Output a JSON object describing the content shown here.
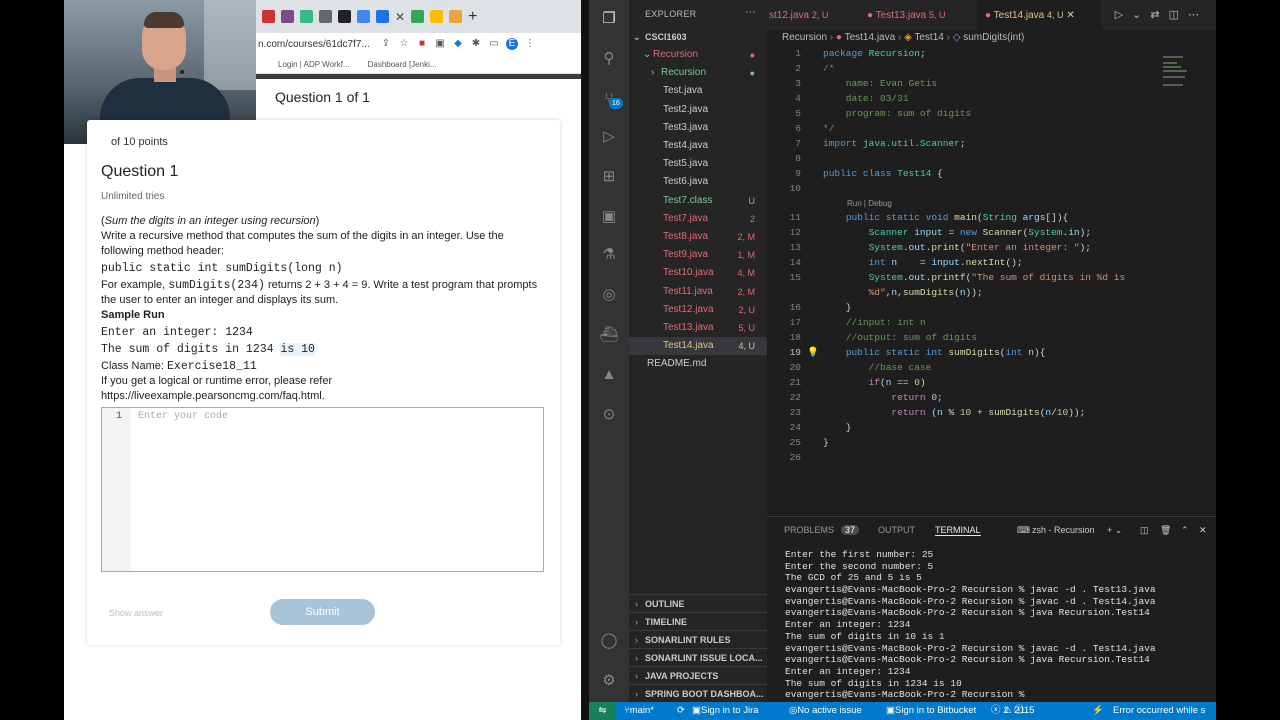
{
  "browser": {
    "url": "n.com/courses/61dc7f7...",
    "bookmarks": [
      "Login | ADP Workf...",
      "Dashboard [Jenki..."
    ],
    "question_header": "Question 1 of 1",
    "points_cut": "of 10 points",
    "question_title": "Question 1",
    "tries": "Unlimited tries",
    "prompt_italic": "Sum the digits in an integer using recursion",
    "prompt_line1": "Write a recursive method that computes the sum of the digits in an integer. Use the following method header:",
    "method_header": "public static int sumDigits(long n)",
    "example_prefix": "For example,",
    "example_code": "sumDigits(234)",
    "example_suffix": "returns 2 + 3 + 4 = 9. Write a test program that prompts the user to enter an integer and displays its sum.",
    "sample_run_label": "Sample Run",
    "sample_line1": "Enter an integer: 1234",
    "sample_line2a": "The sum of digits in 1234",
    "sample_line2b": "is 10",
    "class_name_label": "Class Name:",
    "class_name": "Exercise18_11",
    "error_note": "If you get a logical or runtime error, please refer https://liveexample.pearsoncmg.com/faq.html.",
    "editor_line": "1",
    "editor_placeholder": "Enter your code",
    "show_answer": "Show answer",
    "submit": "Submit"
  },
  "vscode": {
    "explorer_title": "EXPLORER",
    "project": "CSCI1603",
    "files": [
      {
        "name": "Recursion",
        "status": "",
        "color": "#e06c75",
        "indent": 2,
        "folder": "open"
      },
      {
        "name": "Recursion",
        "status": "",
        "color": "#73c991",
        "indent": 3,
        "folder": "closed"
      },
      {
        "name": "Test.java",
        "status": "",
        "color": "#cccccc",
        "indent": 3
      },
      {
        "name": "Test2.java",
        "status": "",
        "color": "#cccccc",
        "indent": 3
      },
      {
        "name": "Test3.java",
        "status": "",
        "color": "#cccccc",
        "indent": 3
      },
      {
        "name": "Test4.java",
        "status": "",
        "color": "#cccccc",
        "indent": 3
      },
      {
        "name": "Test5.java",
        "status": "",
        "color": "#cccccc",
        "indent": 3
      },
      {
        "name": "Test6.java",
        "status": "",
        "color": "#cccccc",
        "indent": 3
      },
      {
        "name": "Test7.class",
        "status": "U",
        "color": "#73c991",
        "indent": 3
      },
      {
        "name": "Test7.java",
        "status": "2",
        "color": "#e06c75",
        "indent": 3
      },
      {
        "name": "Test8.java",
        "status": "2, M",
        "color": "#e06c75",
        "indent": 3
      },
      {
        "name": "Test9.java",
        "status": "1, M",
        "color": "#e06c75",
        "indent": 3
      },
      {
        "name": "Test10.java",
        "status": "4, M",
        "color": "#e06c75",
        "indent": 3
      },
      {
        "name": "Test11.java",
        "status": "2, M",
        "color": "#e06c75",
        "indent": 3
      },
      {
        "name": "Test12.java",
        "status": "2, U",
        "color": "#e06c75",
        "indent": 3
      },
      {
        "name": "Test13.java",
        "status": "5, U",
        "color": "#e06c75",
        "indent": 3
      },
      {
        "name": "Test14.java",
        "status": "4, U",
        "color": "#e2c08d",
        "indent": 3,
        "selected": true
      },
      {
        "name": "README.md",
        "status": "",
        "color": "#cccccc",
        "indent": 2
      }
    ],
    "panels": [
      "OUTLINE",
      "TIMELINE",
      "SONARLINT RULES",
      "SONARLINT ISSUE LOCA...",
      "JAVA PROJECTS",
      "SPRING BOOT DASHBOA..."
    ],
    "tabs": [
      {
        "name": "st12.java",
        "status": "2, U"
      },
      {
        "name": "Test13.java",
        "status": "5, U"
      },
      {
        "name": "Test14.java",
        "status": "4, U"
      }
    ],
    "breadcrumb": [
      "Recursion",
      "Test14.java",
      "Test14",
      "sumDigits(int)"
    ],
    "codelens": "Run | Debug",
    "problems_label": "PROBLEMS",
    "problems_count": "37",
    "output_label": "OUTPUT",
    "terminal_label": "TERMINAL",
    "terminal_name": "zsh - Recursion",
    "terminal_lines": [
      "Enter the first number: 25",
      "Enter the second number: 5",
      "The GCD of 25 and 5 is 5",
      "evangertis@Evans-MacBook-Pro-2 Recursion % javac -d . Test13.java",
      "evangertis@Evans-MacBook-Pro-2 Recursion % javac -d . Test14.java",
      "evangertis@Evans-MacBook-Pro-2 Recursion % java Recursion.Test14",
      "Enter an integer: 1234",
      "The sum of digits in 10 is 1",
      "evangertis@Evans-MacBook-Pro-2 Recursion % javac -d . Test14.java",
      "evangertis@Evans-MacBook-Pro-2 Recursion % java Recursion.Test14",
      "Enter an integer: 1234",
      "The sum of digits in 1234 is 10",
      "evangertis@Evans-MacBook-Pro-2 Recursion % "
    ],
    "status": {
      "branch": "main*",
      "jira": "Sign in to Jira",
      "issue": "No active issue",
      "bitbucket": "Sign in to Bitbucket",
      "errors": "1",
      "warnings": "21",
      "info": "15",
      "message": "Error occurred while s"
    }
  }
}
